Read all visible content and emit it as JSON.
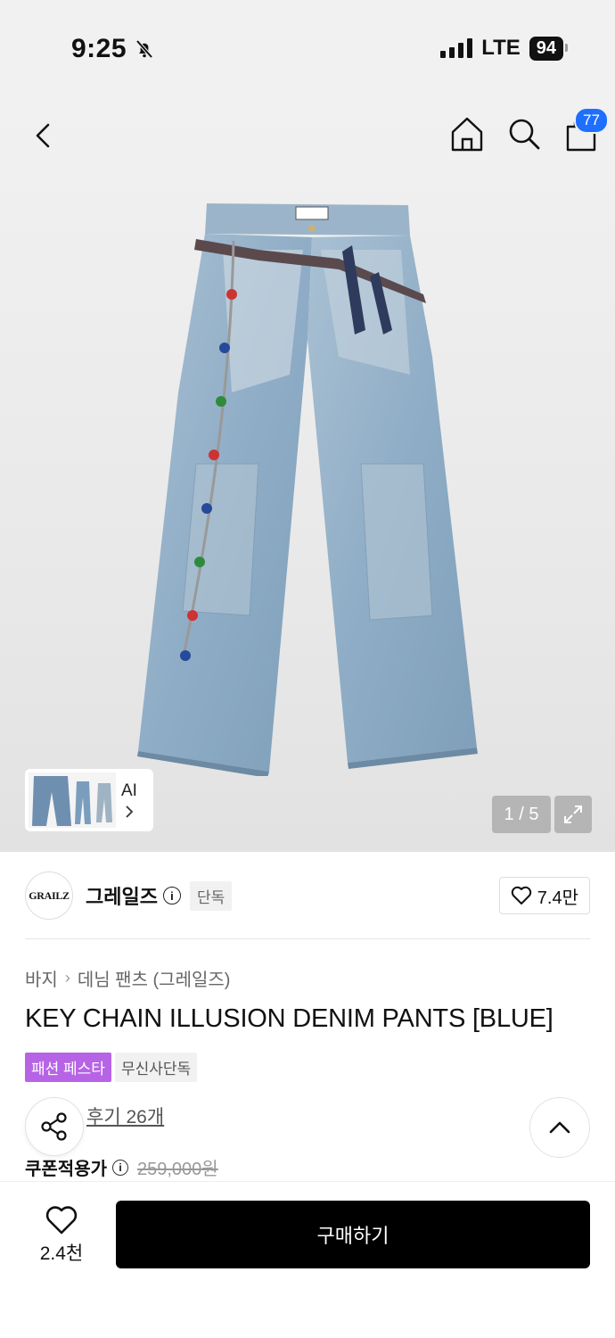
{
  "status_bar": {
    "time": "9:25",
    "network": "LTE",
    "battery": "94"
  },
  "header": {
    "cart_count": "77"
  },
  "gallery": {
    "thumb_label": "AI",
    "pager": "1 / 5"
  },
  "brand": {
    "logo_text": "GRAILZ",
    "name": "그레일즈",
    "badge": "단독",
    "like_count": "7.4만"
  },
  "breadcrumb": {
    "category": "바지",
    "subcategory": "데님 팬츠 (그레일즈)"
  },
  "product": {
    "title": "KEY CHAIN ILLUSION DENIM PANTS [BLUE]",
    "tags": [
      "패션 페스타",
      "무신사단독"
    ],
    "review_link": "후기 26개",
    "price_label": "쿠폰적용가",
    "original_price": "259,000원"
  },
  "bottom_bar": {
    "wish_count": "2.4천",
    "buy_label": "구매하기"
  },
  "colors": {
    "accent_blue": "#1f6fff",
    "tag_purple": "#b763e6",
    "buy_button": "#000000"
  }
}
